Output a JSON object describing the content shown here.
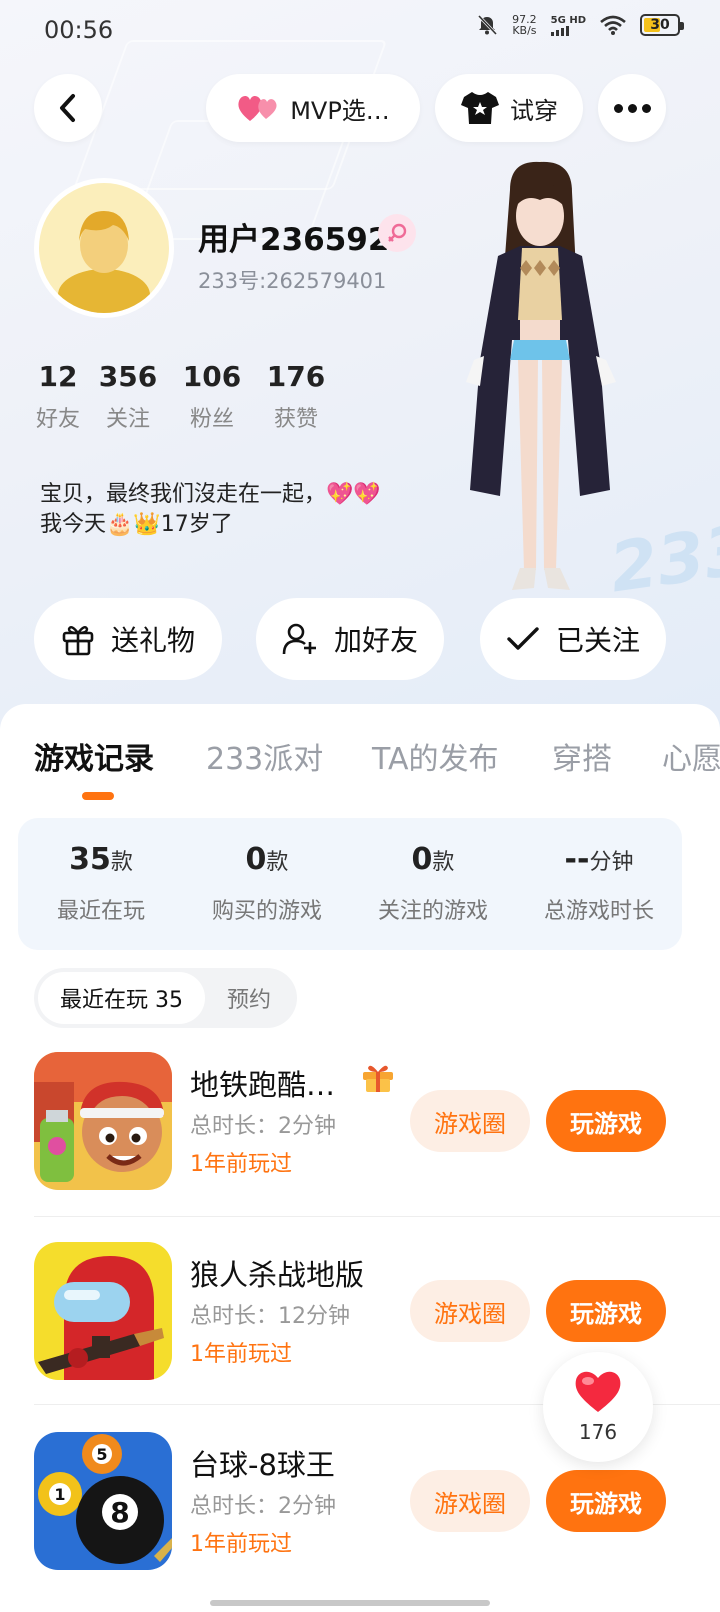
{
  "status_bar": {
    "time": "00:56",
    "net_speed_value": "97.2",
    "net_speed_unit": "KB/s",
    "network": "5G HD",
    "battery": "30"
  },
  "header": {
    "mvp_label": "MVP选…",
    "try_on_label": "试穿"
  },
  "profile": {
    "username": "用户236592",
    "gender": "female",
    "user_id": "233号:262579401",
    "stats": [
      {
        "value": "12",
        "label": "好友"
      },
      {
        "value": "356",
        "label": "关注"
      },
      {
        "value": "106",
        "label": "粉丝"
      },
      {
        "value": "176",
        "label": "获赞"
      }
    ],
    "bio_line1": "宝贝，最终我们沒走在一起，💖💖",
    "bio_line2": "我今天🎂👑17岁了"
  },
  "actions": {
    "gift_label": "送礼物",
    "add_friend_label": "加好友",
    "followed_label": "已关注"
  },
  "tabs": [
    "游戏记录",
    "233派对",
    "TA的发布",
    "穿搭",
    "心愿"
  ],
  "summary": [
    {
      "value": "35",
      "unit": "款",
      "label": "最近在玩"
    },
    {
      "value": "0",
      "unit": "款",
      "label": "购买的游戏"
    },
    {
      "value": "0",
      "unit": "款",
      "label": "关注的游戏"
    },
    {
      "value": "--",
      "unit": "分钟",
      "label": "总游戏时长"
    }
  ],
  "subtabs": {
    "recent": "最近在玩 35",
    "reserve": "预约"
  },
  "games": [
    {
      "name": "地铁跑酷…",
      "duration": "总时长：2分钟",
      "last_played": "1年前玩过"
    },
    {
      "name": "狼人杀战地版",
      "duration": "总时长：12分钟",
      "last_played": "1年前玩过"
    },
    {
      "name": "台球-8球王",
      "duration": "总时长：2分钟",
      "last_played": "1年前玩过"
    }
  ],
  "game_buttons": {
    "circle": "游戏圈",
    "play": "玩游戏"
  },
  "like_count": "176",
  "colors": {
    "accent": "#ff7310",
    "accent_light": "#fdeee4",
    "summary_bg": "#f1f6fc"
  }
}
